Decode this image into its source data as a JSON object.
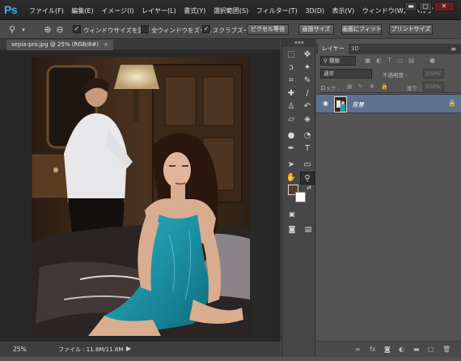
{
  "app": {
    "logo": "Ps"
  },
  "menu": {
    "items": [
      "ファイル(F)",
      "編集(E)",
      "イメージ(I)",
      "レイヤー(L)",
      "書式(Y)",
      "選択範囲(S)",
      "フィルター(T)",
      "3D(D)",
      "表示(V)",
      "ウィンドウ(W)",
      "ヘルプ"
    ]
  },
  "window_controls": {
    "minimize": "▬",
    "maximize": "▢",
    "close": "✕"
  },
  "options": {
    "check_resize": "ウィンドウサイズを変更",
    "check_all_windows": "全ウィンドウをズーム",
    "check_scrubby": "スクラブズーム",
    "btn_pixels": "ピクセル等倍",
    "btn_fit_screen": "画面サイズ",
    "btn_fill_screen": "画面にフィット",
    "btn_print_size": "プリントサイズ",
    "checkmark": "✓"
  },
  "document": {
    "tab_title": "sepia-pro.jpg @ 25% (RGB/8#)",
    "tab_close": "×",
    "zoom": "25%",
    "file_info": "ファイル : 11.8M/11.8M",
    "status_arrow": "▶"
  },
  "tools": [
    {
      "name": "marquee",
      "glyph": "⬚"
    },
    {
      "name": "move",
      "glyph": "✥"
    },
    {
      "name": "lasso",
      "glyph": "ↄ"
    },
    {
      "name": "magic-wand",
      "glyph": "✦"
    },
    {
      "name": "crop",
      "glyph": "⌗"
    },
    {
      "name": "eyedropper",
      "glyph": "✎"
    },
    {
      "name": "healing",
      "glyph": "✚"
    },
    {
      "name": "brush",
      "glyph": "∕"
    },
    {
      "name": "stamp",
      "glyph": "♙"
    },
    {
      "name": "history-brush",
      "glyph": "↶"
    },
    {
      "name": "eraser",
      "glyph": "▱"
    },
    {
      "name": "paint-bucket",
      "glyph": "◈"
    },
    {
      "name": "blur",
      "glyph": "●"
    },
    {
      "name": "dodge",
      "glyph": "◔"
    },
    {
      "name": "pen",
      "glyph": "✒"
    },
    {
      "name": "type",
      "glyph": "T"
    },
    {
      "name": "path-select",
      "glyph": "➤"
    },
    {
      "name": "shape",
      "glyph": "▭"
    },
    {
      "name": "hand",
      "glyph": "✋"
    },
    {
      "name": "zoom",
      "glyph": "⚲"
    }
  ],
  "colors": {
    "foreground": "#5a3a2a",
    "background": "#ffffff",
    "accent": "#5c7290"
  },
  "layers_panel": {
    "tab_layers": "レイヤー",
    "tab_3d": "3D",
    "panel_menu": "≡",
    "filter_kind": "種類",
    "blend_mode": "通常",
    "opacity_label": "不透明度 :",
    "opacity_value": "100%",
    "lock_label": "ロック :",
    "fill_label": "塗り :",
    "fill_value": "100%",
    "layer": {
      "name": "背景",
      "visible_icon": "👁",
      "lock_icon": "🔒"
    },
    "footer_icons": [
      "link-icon",
      "fx-icon",
      "mask-icon",
      "adjustment-icon",
      "group-icon",
      "new-layer-icon",
      "trash-icon"
    ]
  }
}
